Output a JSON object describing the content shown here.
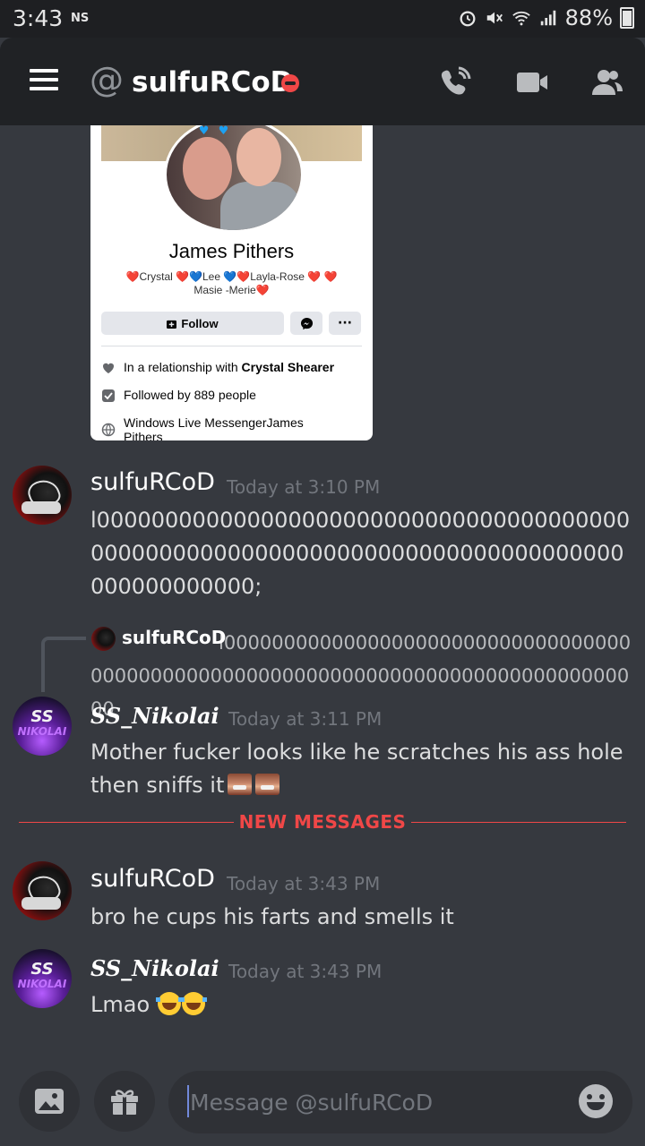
{
  "status_bar": {
    "time": "3:43",
    "carrier": "NS",
    "battery": "88%"
  },
  "header": {
    "title": "sulfuRCoD",
    "status": "dnd"
  },
  "attachment": {
    "name": "James Pithers",
    "bio": "❤️Crystal ❤️💙Lee 💙❤️Layla-Rose ❤️ ❤️ Masie -Merie❤️",
    "follow_label": "Follow",
    "more_label": "···",
    "info": [
      {
        "pre": "In a relationship with ",
        "bold": "Crystal Shearer"
      },
      {
        "pre": "Followed by 889 people",
        "bold": ""
      },
      {
        "pre": "Windows Live MessengerJames Pithers",
        "bold": ""
      }
    ]
  },
  "messages": [
    {
      "author": "sulfuRCoD",
      "time": "Today at 3:10 PM",
      "content": "l000000000000000000000000000000000000000000000000000000000000000000000000000000000000000000;"
    },
    {
      "reply_to": {
        "author": "sulfuRCoD",
        "snippet": "l000000000000000000000000000000000000000000000000000000000000000000000000000000000"
      },
      "author": "SS_Nikolai",
      "time": "Today at 3:11 PM",
      "content": "Mother fucker looks like he scratches his ass hole then sniffs it"
    },
    {
      "author": "sulfuRCoD",
      "time": "Today at 3:43 PM",
      "content": "bro he cups his farts and smells it"
    },
    {
      "author": "SS_Nikolai",
      "time": "Today at 3:43 PM",
      "content": "Lmao"
    }
  ],
  "avatars": {
    "nikolai_line1": "SS",
    "nikolai_line2": "NIKOLAI"
  },
  "new_messages_label": "NEW MESSAGES",
  "composer": {
    "placeholder": "Message @sulfuRCoD"
  },
  "icons": [
    "menu-icon",
    "at-icon",
    "call-icon",
    "video-icon",
    "members-icon",
    "image-icon",
    "gift-icon",
    "emoji-icon",
    "messenger-icon",
    "heart-icon",
    "follow-icon",
    "globe-icon"
  ],
  "colors": {
    "accent": "#7289da",
    "new_messages": "#f04747",
    "background": "#36393f",
    "header": "#202225"
  }
}
